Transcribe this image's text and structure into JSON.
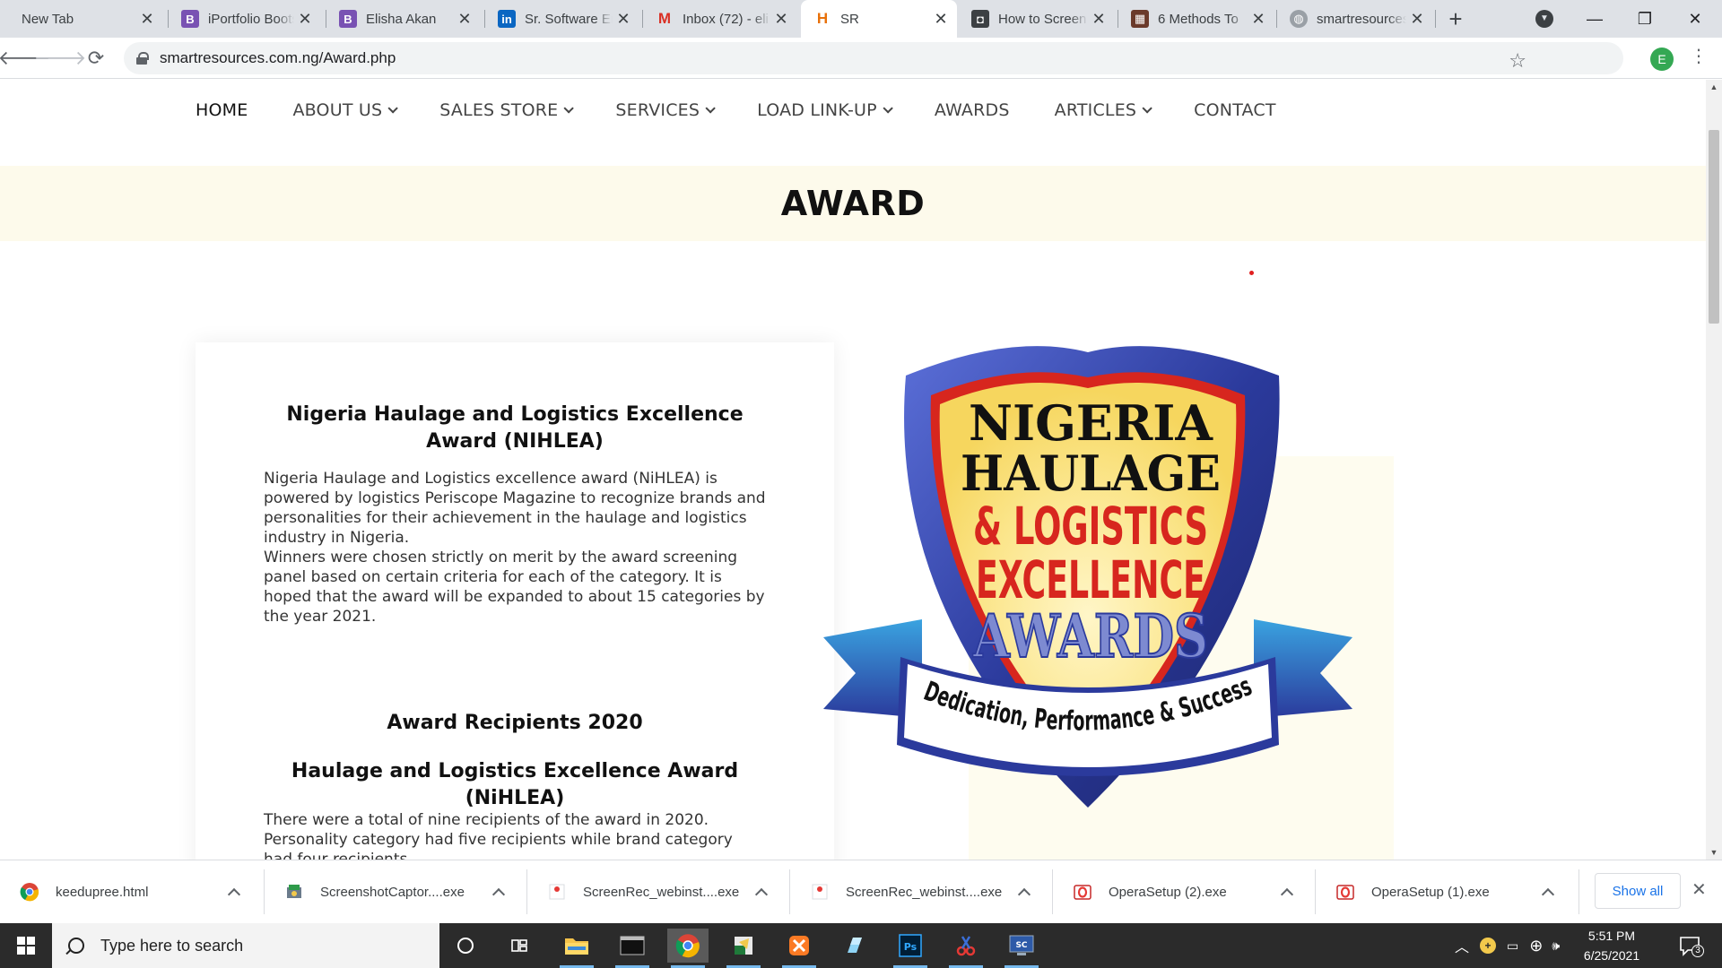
{
  "browser": {
    "tabs": [
      {
        "title": "New Tab",
        "icon": "none",
        "active": false
      },
      {
        "title": "iPortfolio Bootstrap",
        "icon": "bootstrap-icon",
        "active": false
      },
      {
        "title": "Elisha Akan",
        "icon": "bootstrap-icon",
        "active": false
      },
      {
        "title": "Sr. Software Engineer",
        "icon": "linkedin-icon",
        "active": false
      },
      {
        "title": "Inbox (72) - eli",
        "icon": "gmail-icon",
        "active": false
      },
      {
        "title": "SR",
        "icon": "site-icon",
        "active": true
      },
      {
        "title": "How to Screen",
        "icon": "camera-icon",
        "active": false
      },
      {
        "title": "6 Methods To",
        "icon": "article-icon",
        "active": false
      },
      {
        "title": "smartresources",
        "icon": "globe-icon",
        "active": false
      }
    ],
    "url": "smartresources.com.ng/Award.php",
    "profile_initial": "E"
  },
  "site": {
    "nav": [
      {
        "label": "HOME",
        "dropdown": false,
        "active": true
      },
      {
        "label": "ABOUT US",
        "dropdown": true,
        "active": false
      },
      {
        "label": "SALES STORE",
        "dropdown": true,
        "active": false
      },
      {
        "label": "SERVICES",
        "dropdown": true,
        "active": false
      },
      {
        "label": "LOAD LINK-UP",
        "dropdown": true,
        "active": false
      },
      {
        "label": "AWARDS",
        "dropdown": false,
        "active": false
      },
      {
        "label": "ARTICLES",
        "dropdown": true,
        "active": false
      },
      {
        "label": "CONTACT",
        "dropdown": false,
        "active": false
      }
    ],
    "page_title": "AWARD",
    "award_heading": "Nigeria Haulage and Logistics Excellence Award (NIHLEA)",
    "intro_paragraph": "Nigeria Haulage and Logistics excellence award (NiHLEA) is powered by logistics Periscope Magazine to recognize brands and personalities for their achievement in the haulage and logistics industry in Nigeria.",
    "criteria_paragraph": "Winners were chosen strictly on merit by the award screening panel based on certain criteria for each of the category. It is hoped that the award will be expanded to about 15 categories by the year 2021.",
    "recipients_heading": "Award Recipients 2020",
    "sub_heading": "Haulage and Logistics Excellence Award (NiHLEA)",
    "recipients_paragraph": "There were a total of nine recipients of the award in 2020. Personality category had five recipients while brand category had four recipients.",
    "badge": {
      "line1": "NIGERIA",
      "line2": "HAULAGE",
      "line3": "& LOGISTICS",
      "line4": "EXCELLENCE",
      "line5": "AWARDS",
      "ribbon": "Dedication, Performance & Success",
      "colors": {
        "blue": "#2b3a9c",
        "red": "#d7261e",
        "yellow": "#fbe58a",
        "light_blue": "#3aa3e0"
      }
    }
  },
  "downloads": {
    "items": [
      {
        "name": "keedupree.html",
        "icon": "chrome-icon"
      },
      {
        "name": "ScreenshotCaptor....exe",
        "icon": "installer-icon"
      },
      {
        "name": "ScreenRec_webinst....exe",
        "icon": "screenrec-icon"
      },
      {
        "name": "ScreenRec_webinst....exe",
        "icon": "screenrec-icon"
      },
      {
        "name": "OperaSetup (2).exe",
        "icon": "opera-icon"
      },
      {
        "name": "OperaSetup (1).exe",
        "icon": "opera-icon"
      }
    ],
    "show_all_label": "Show all"
  },
  "taskbar": {
    "search_placeholder": "Type here to search",
    "apps": [
      "cortana-icon",
      "task-view-icon",
      "file-explorer-icon",
      "terminal-icon",
      "chrome-icon",
      "excel-installer-icon",
      "xampp-icon",
      "app-icon",
      "photoshop-icon",
      "snipping-tool-icon",
      "screen-capture-icon"
    ],
    "time": "5:51 PM",
    "date": "6/25/2021",
    "notification_count": "3"
  }
}
